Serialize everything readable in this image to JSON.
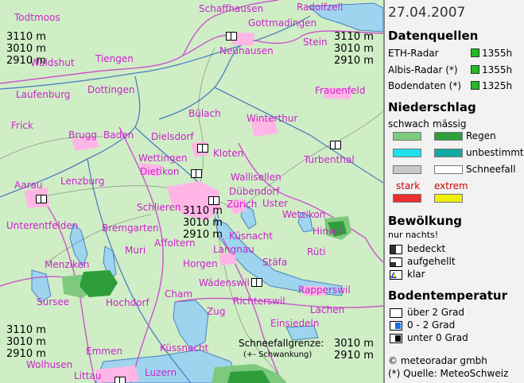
{
  "date": "27.04.2007",
  "altitudes": {
    "top_left": "3110 m\n3010 m\n2910 m",
    "top_right": "3110 m\n3010 m\n2910 m",
    "center": "3110 m\n3010 m\n2910 m",
    "bottom_left": "3110 m\n3010 m\n2910 m"
  },
  "snowline": {
    "label": "Schneefallgrenze:",
    "note": "(+- Schwankung)",
    "values": "3010 m\n2910 m"
  },
  "places": [
    {
      "name": "Todtmoos"
    },
    {
      "name": "Schaffhausen"
    },
    {
      "name": "Radolfzell"
    },
    {
      "name": "Gottmadingen"
    },
    {
      "name": "Stein"
    },
    {
      "name": "Waldshut"
    },
    {
      "name": "Tiengen"
    },
    {
      "name": "Neuhausen"
    },
    {
      "name": "Laufenburg"
    },
    {
      "name": "Dottingen"
    },
    {
      "name": "Frauenfeld"
    },
    {
      "name": "Bülach"
    },
    {
      "name": "Winterthur"
    },
    {
      "name": "Frick"
    },
    {
      "name": "Brugg"
    },
    {
      "name": "Baden"
    },
    {
      "name": "Dielsdorf"
    },
    {
      "name": "Wettingen"
    },
    {
      "name": "Kloten"
    },
    {
      "name": "Dietikon"
    },
    {
      "name": "Turbenthal"
    },
    {
      "name": "Aarau"
    },
    {
      "name": "Lenzburg"
    },
    {
      "name": "Wallisellen"
    },
    {
      "name": "Dübendorf"
    },
    {
      "name": "Zürich"
    },
    {
      "name": "Uster"
    },
    {
      "name": "Schlieren"
    },
    {
      "name": "Wetzikon"
    },
    {
      "name": "Unterentfelden"
    },
    {
      "name": "Bremgarten"
    },
    {
      "name": "Hinwil"
    },
    {
      "name": "Affoltern"
    },
    {
      "name": "Küsnacht"
    },
    {
      "name": "Muri"
    },
    {
      "name": "Langnau"
    },
    {
      "name": "Rüti"
    },
    {
      "name": "Horgen"
    },
    {
      "name": "Stäfa"
    },
    {
      "name": "Menziken"
    },
    {
      "name": "Wädenswil"
    },
    {
      "name": "Rapperswil"
    },
    {
      "name": "Sursee"
    },
    {
      "name": "Hochdorf"
    },
    {
      "name": "Cham"
    },
    {
      "name": "Richterswil"
    },
    {
      "name": "Zug"
    },
    {
      "name": "Lachen"
    },
    {
      "name": "Einsiedeln"
    },
    {
      "name": "Emmen"
    },
    {
      "name": "Küssnacht"
    },
    {
      "name": "Wolhusen"
    },
    {
      "name": "Littau"
    },
    {
      "name": "Luzern"
    }
  ],
  "legend": {
    "datenquellen": {
      "title": "Datenquellen",
      "rows": [
        {
          "name": "ETH-Radar",
          "time": "1355h",
          "color": "#22bb22"
        },
        {
          "name": "Albis-Radar (*)",
          "time": "1355h",
          "color": "#22bb22"
        },
        {
          "name": "Bodendaten (*)",
          "time": "1325h",
          "color": "#22bb22"
        }
      ]
    },
    "niederschlag": {
      "title": "Niederschlag",
      "col_schwach": "schwach",
      "col_massig": "mässig",
      "regen": "Regen",
      "unbestimmt": "unbestimmt",
      "schneefall": "Schneefall",
      "col_stark": "stark",
      "col_extrem": "extrem",
      "colors": {
        "regen_schwach": "#7fc97f",
        "regen_massig": "#2e9e3a",
        "unbest_schwach": "#22e0e8",
        "unbest_massig": "#12a9a2",
        "schnee_schwach": "#c8c8c8",
        "schnee_massig": "#ffffff",
        "stark": "#e83030",
        "extrem": "#f0f000"
      }
    },
    "bewoelkung": {
      "title": "Bewölkung",
      "subtitle": "nur nachts!",
      "items": [
        "bedeckt",
        "aufgehellt",
        "klar"
      ]
    },
    "bodentemperatur": {
      "title": "Bodentemperatur",
      "items": [
        {
          "label": "über 2 Grad",
          "color": "#ffffff"
        },
        {
          "label": "0 - 2 Grad",
          "color": "#1e6fe0"
        },
        {
          "label": "unter 0 Grad",
          "color": "#000000"
        }
      ]
    },
    "copyright": "© meteoradar gmbh",
    "source": "(*) Quelle: MeteoSchweiz"
  }
}
